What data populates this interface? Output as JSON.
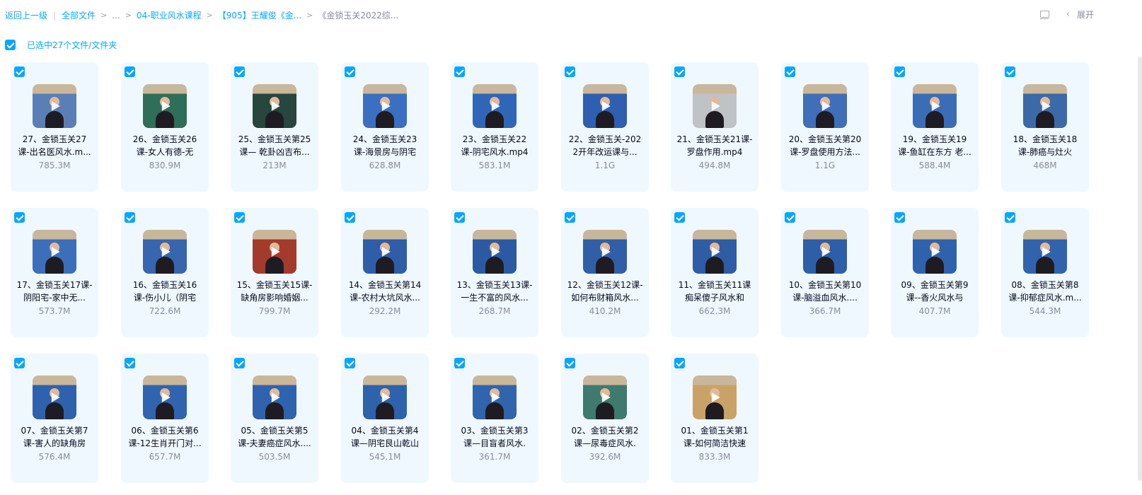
{
  "breadcrumb": {
    "back": "返回上一级",
    "items": [
      "全部文件",
      "...",
      "04-职业风水课程",
      "【905】王耀俊《金...",
      "《金锁玉关2022综..."
    ]
  },
  "toolbar": {
    "view_icon": "list-view-icon",
    "expand_label": "展开"
  },
  "selection": {
    "text": "已选中27个文件/文件夹",
    "checked": true
  },
  "files": [
    {
      "l1": "27、金锁玉关27",
      "l2": "课-出名医风水.m...",
      "size": "785.3M",
      "bg": "#5a7fb6"
    },
    {
      "l1": "26、金锁玉关26",
      "l2": "课-女人有德-无",
      "size": "830.9M",
      "bg": "#2f6e58"
    },
    {
      "l1": "25、金锁玉关第25",
      "l2": "课— 乾卦凶吉布...",
      "size": "213M",
      "bg": "#26463e"
    },
    {
      "l1": "24、金锁玉关23",
      "l2": "课-海景房与阴宅",
      "size": "628.8M",
      "bg": "#3a6fc2"
    },
    {
      "l1": "23、金锁玉关22",
      "l2": "课-阴宅风水.mp4",
      "size": "583.1M",
      "bg": "#2f66b8"
    },
    {
      "l1": "22、金锁玉关-202",
      "l2": "2开年改运课与...",
      "size": "1.1G",
      "bg": "#2e5fb0"
    },
    {
      "l1": "21、金锁玉关21课-",
      "l2": "罗盘作用.mp4",
      "size": "494.8M",
      "bg": "#bfc3c6"
    },
    {
      "l1": "20、金锁玉关第20",
      "l2": "课-罗盘使用方法...",
      "size": "1.1G",
      "bg": "#3f6fb8"
    },
    {
      "l1": "19、金锁玉关19",
      "l2": "课-鱼缸在东方 老...",
      "size": "588.4M",
      "bg": "#3a6db5"
    },
    {
      "l1": "18、金锁玉关18",
      "l2": "课-肺癌与灶火",
      "size": "468M",
      "bg": "#3c6aa8"
    },
    {
      "l1": "17、金锁玉关17课-",
      "l2": "阴阳宅-家中无...",
      "size": "573.7M",
      "bg": "#3c6fba"
    },
    {
      "l1": "16、金锁玉关16",
      "l2": "课-伤小儿（阴宅",
      "size": "722.6M",
      "bg": "#3765ae"
    },
    {
      "l1": "15、金锁玉关15课-",
      "l2": "缺角房影响婚姻...",
      "size": "799.7M",
      "bg": "#a33b2c"
    },
    {
      "l1": "14、金锁玉关第14",
      "l2": "课-农村大坑风水...",
      "size": "292.2M",
      "bg": "#2f5da8"
    },
    {
      "l1": "13、金锁玉关13课-",
      "l2": "一生不富的风水...",
      "size": "268.7M",
      "bg": "#2b5aa3"
    },
    {
      "l1": "12、金锁玉关12课-",
      "l2": "如何布财箱风水...",
      "size": "410.2M",
      "bg": "#305fa8"
    },
    {
      "l1": "11、金锁玉关11课",
      "l2": "痴呆傻子风水和",
      "size": "662.3M",
      "bg": "#2e5ca5"
    },
    {
      "l1": "10、金锁玉关第10",
      "l2": "课-脑溢血风水....",
      "size": "366.7M",
      "bg": "#2d5ea8"
    },
    {
      "l1": "09、金锁玉关第9",
      "l2": "课--香火风水与",
      "size": "407.7M",
      "bg": "#2f62ad"
    },
    {
      "l1": "08、金锁玉关第8",
      "l2": "课-抑郁症风水.m...",
      "size": "544.3M",
      "bg": "#3163ad"
    },
    {
      "l1": "07、金锁玉关第7",
      "l2": "课-害人的缺角房",
      "size": "576.4M",
      "bg": "#2f62ad"
    },
    {
      "l1": "06、金锁玉关第6",
      "l2": "课-12生肖开门对...",
      "size": "657.7M",
      "bg": "#3064ae"
    },
    {
      "l1": "05、金锁玉关第5",
      "l2": "课-夫妻癌症风水....",
      "size": "503.5M",
      "bg": "#2f63ad"
    },
    {
      "l1": "04、金锁玉关第4",
      "l2": "课—阴宅艮山乾山",
      "size": "545.1M",
      "bg": "#2e62ab"
    },
    {
      "l1": "03、金锁玉关第3",
      "l2": "课—目盲者风水.",
      "size": "361.7M",
      "bg": "#3064ad"
    },
    {
      "l1": "02、金锁玉关第2",
      "l2": "课—尿毒症风水.",
      "size": "392.6M",
      "bg": "#3f7a6e"
    },
    {
      "l1": "01、金锁玉关第1",
      "l2": "课-如何简洁快速",
      "size": "833.3M",
      "bg": "#c9a267"
    }
  ]
}
